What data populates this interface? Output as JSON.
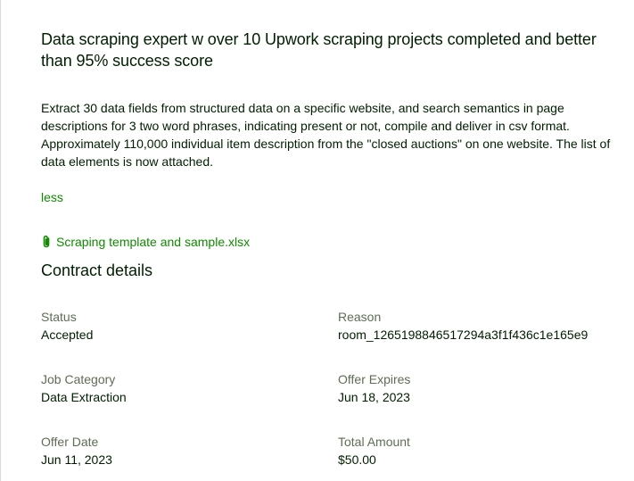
{
  "job": {
    "title": "Data scraping expert w over 10 Upwork scraping projects completed and better than 95% success score",
    "description": "Extract 30 data fields from structured data on a specific website, and search semantics in page descriptions for 3 two word phrases, indicating present or not, compile and deliver in csv format. Approximately 110,000 individual item description from the \"closed auctions\" on one website. The list of data elements is now attached.",
    "less_label": "less",
    "attachment_name": "Scraping template and sample.xlsx"
  },
  "contract": {
    "title": "Contract details",
    "status_label": "Status",
    "status_value": "Accepted",
    "reason_label": "Reason",
    "reason_value": "room_1265198846517294a3f1f436c1e165e9",
    "category_label": "Job Category",
    "category_value": "Data Extraction",
    "expires_label": "Offer Expires",
    "expires_value": "Jun 18, 2023",
    "offer_date_label": "Offer Date",
    "offer_date_value": "Jun 11, 2023",
    "amount_label": "Total Amount",
    "amount_value": "$50.00"
  },
  "colors": {
    "text": "#001e00",
    "muted": "#5e6d55",
    "link": "#108a00",
    "border": "#d5e0d5"
  },
  "icons": {
    "attachment": "paperclip-icon"
  }
}
